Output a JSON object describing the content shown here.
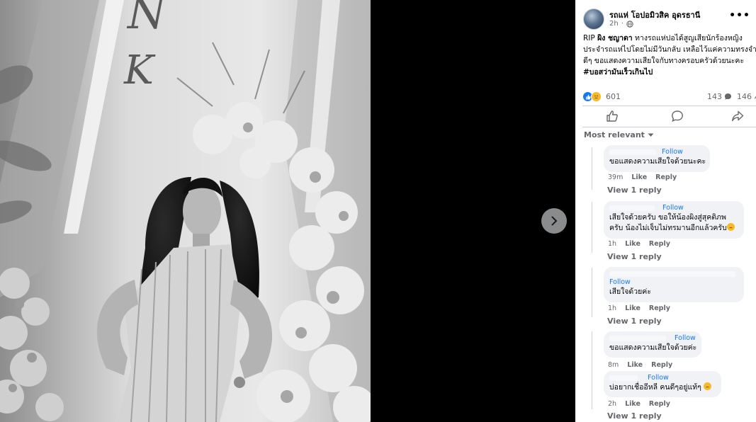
{
  "post": {
    "page_name": "รถแห่ โอปอมิวสิค อุดรธานี",
    "time": "2h",
    "body_lines": [
      {
        "prefix": "RIP ",
        "bold": "ผิง ชญาดา",
        "rest": " ทางรถแห่ปอได้สูญเสียนักร้องหญิง"
      },
      {
        "prefix": "",
        "bold": "",
        "rest": "ประจำรถแห่ไปโดยไม่มีวันกลับ เหลือไว้แค่ความทรงจำ"
      },
      {
        "prefix": "",
        "bold": "",
        "rest": "ดีๆ ขอแสดงความเสียใจกับทางครอบครัวด้วยนะคะ"
      },
      {
        "prefix": "",
        "bold": "#บอสว่ามันเร็วเกินไป",
        "rest": ""
      }
    ],
    "reaction_count": "601",
    "comment_count": "143",
    "share_count": "146"
  },
  "icons": {
    "like": "like-icon",
    "comment": "comment-icon",
    "share": "share-icon",
    "next": "chevron-right-icon",
    "more": "more-icon",
    "globe": "globe-icon"
  },
  "ui": {
    "more_label": "•••",
    "sort_label": "Most relevant"
  },
  "comments": [
    {
      "follow": "Follow",
      "lines": [
        "ขอแสดงความเสียใจด้วยนะคะ"
      ],
      "emoji": false,
      "time": "39m",
      "like": "Like",
      "reply": "Reply",
      "view_replies": "View 1 reply"
    },
    {
      "follow": "Follow",
      "lines": [
        "เสียใจด้วยครับ ขอให้น้องผิงสู่สุคติภพ",
        "ครับ น้องไม่เจ็บไม่ทรมานอีกแล้วครับ"
      ],
      "emoji": true,
      "time": "1h",
      "like": "Like",
      "reply": "Reply",
      "view_replies": "View 1 reply"
    },
    {
      "follow": "Follow",
      "lines": [
        "เสียใจด้วยค่ะ"
      ],
      "emoji": false,
      "time": "1h",
      "like": "Like",
      "reply": "Reply",
      "view_replies": "View 1 reply"
    },
    {
      "follow": "Follow",
      "lines": [
        "ขอแสดงความเสียใจด้วยค่ะ"
      ],
      "emoji": false,
      "time": "8m",
      "like": "Like",
      "reply": "Reply",
      "view_replies": ""
    },
    {
      "follow": "Follow",
      "lines": [
        "บ่อยากเชื่ออีหลี คนดีๆอยู่แท้ๆ"
      ],
      "emoji": true,
      "time": "2h",
      "like": "Like",
      "reply": "Reply",
      "view_replies": "View 1 reply"
    }
  ],
  "photo_overlay": {
    "monogram_1": "N",
    "monogram_2": "K"
  },
  "colors": {
    "link": "#1877f2",
    "muted": "#65676b",
    "bubble": "#f0f2f5"
  }
}
